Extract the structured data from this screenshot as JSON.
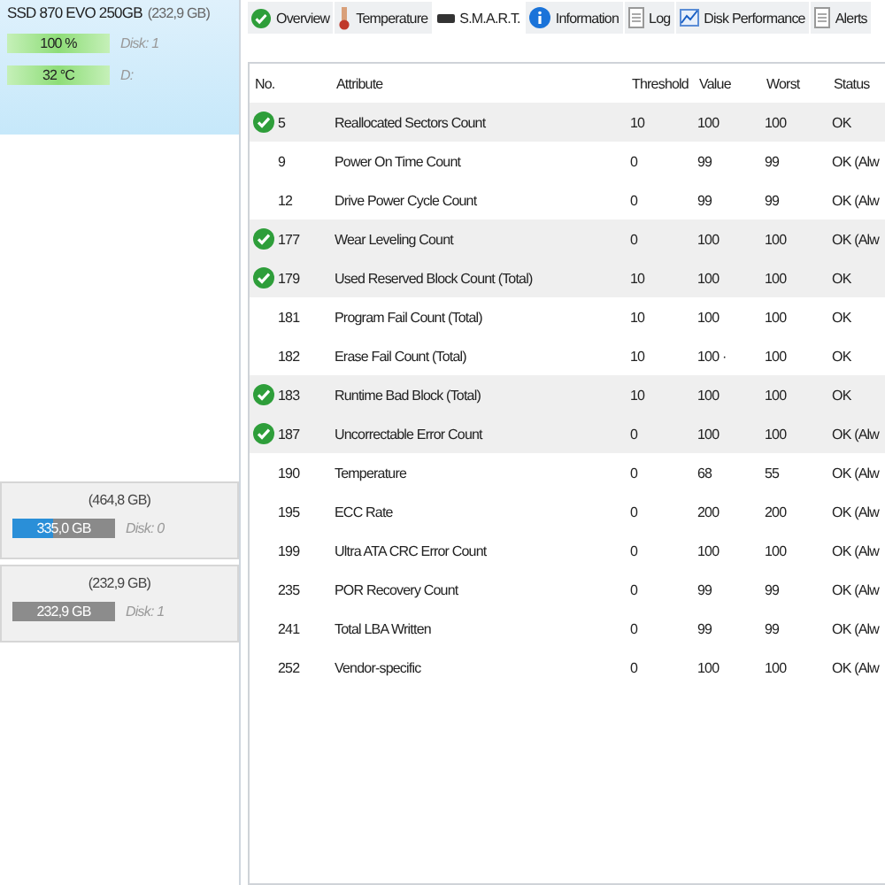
{
  "drive": {
    "name": "SSD 870 EVO 250GB",
    "size": "(232,9 GB)",
    "health": {
      "value": "100 %",
      "disk": "Disk: 1"
    },
    "temperature": {
      "value": "32 °C",
      "letter": "D:"
    }
  },
  "volumes": [
    {
      "size": "(464,8 GB)",
      "bar": "335,0 GB",
      "disk": "Disk: 0",
      "selected": true
    },
    {
      "size": "(232,9 GB)",
      "bar": "232,9 GB",
      "disk": "Disk: 1",
      "selected": false
    }
  ],
  "tabs": [
    {
      "label": "Overview",
      "selected": false
    },
    {
      "label": "Temperature",
      "selected": false
    },
    {
      "label": "S.M.A.R.T.",
      "selected": true
    },
    {
      "label": "Information",
      "selected": false
    },
    {
      "label": "Log",
      "selected": false
    },
    {
      "label": "Disk Performance",
      "selected": false
    },
    {
      "label": "Alerts",
      "selected": false
    }
  ],
  "table": {
    "columns": [
      "No.",
      "Attribute",
      "Threshold",
      "Value",
      "Worst",
      "Status"
    ],
    "rows": [
      {
        "no": "5",
        "attribute": "Reallocated Sectors Count",
        "threshold": "10",
        "value": "100",
        "worst": "100",
        "status": "OK",
        "flagged": true
      },
      {
        "no": "9",
        "attribute": "Power On Time Count",
        "threshold": "0",
        "value": "99",
        "worst": "99",
        "status": "OK (Alw",
        "flagged": false
      },
      {
        "no": "12",
        "attribute": "Drive Power Cycle Count",
        "threshold": "0",
        "value": "99",
        "worst": "99",
        "status": "OK (Alw",
        "flagged": false
      },
      {
        "no": "177",
        "attribute": "Wear Leveling Count",
        "threshold": "0",
        "value": "100",
        "worst": "100",
        "status": "OK (Alw",
        "flagged": true
      },
      {
        "no": "179",
        "attribute": "Used Reserved Block Count (Total)",
        "threshold": "10",
        "value": "100",
        "worst": "100",
        "status": "OK",
        "flagged": true
      },
      {
        "no": "181",
        "attribute": "Program Fail Count (Total)",
        "threshold": "10",
        "value": "100",
        "worst": "100",
        "status": "OK",
        "flagged": false
      },
      {
        "no": "182",
        "attribute": "Erase Fail Count (Total)",
        "threshold": "10",
        "value": "100 ·",
        "worst": "100",
        "status": "OK",
        "flagged": false
      },
      {
        "no": "183",
        "attribute": "Runtime Bad Block (Total)",
        "threshold": "10",
        "value": "100",
        "worst": "100",
        "status": "OK",
        "flagged": true
      },
      {
        "no": "187",
        "attribute": "Uncorrectable Error Count",
        "threshold": "0",
        "value": "100",
        "worst": "100",
        "status": "OK (Alw",
        "flagged": true
      },
      {
        "no": "190",
        "attribute": "Temperature",
        "threshold": "0",
        "value": "68",
        "worst": "55",
        "status": "OK (Alw",
        "flagged": false
      },
      {
        "no": "195",
        "attribute": "ECC Rate",
        "threshold": "0",
        "value": "200",
        "worst": "200",
        "status": "OK (Alw",
        "flagged": false
      },
      {
        "no": "199",
        "attribute": "Ultra ATA CRC Error Count",
        "threshold": "0",
        "value": "100",
        "worst": "100",
        "status": "OK (Alw",
        "flagged": false
      },
      {
        "no": "235",
        "attribute": "POR Recovery Count",
        "threshold": "0",
        "value": "99",
        "worst": "99",
        "status": "OK (Alw",
        "flagged": false
      },
      {
        "no": "241",
        "attribute": "Total LBA Written",
        "threshold": "0",
        "value": "99",
        "worst": "99",
        "status": "OK (Alw",
        "flagged": false
      },
      {
        "no": "252",
        "attribute": "Vendor-specific",
        "threshold": "0",
        "value": "100",
        "worst": "100",
        "status": "OK (Alw",
        "flagged": false
      }
    ]
  }
}
